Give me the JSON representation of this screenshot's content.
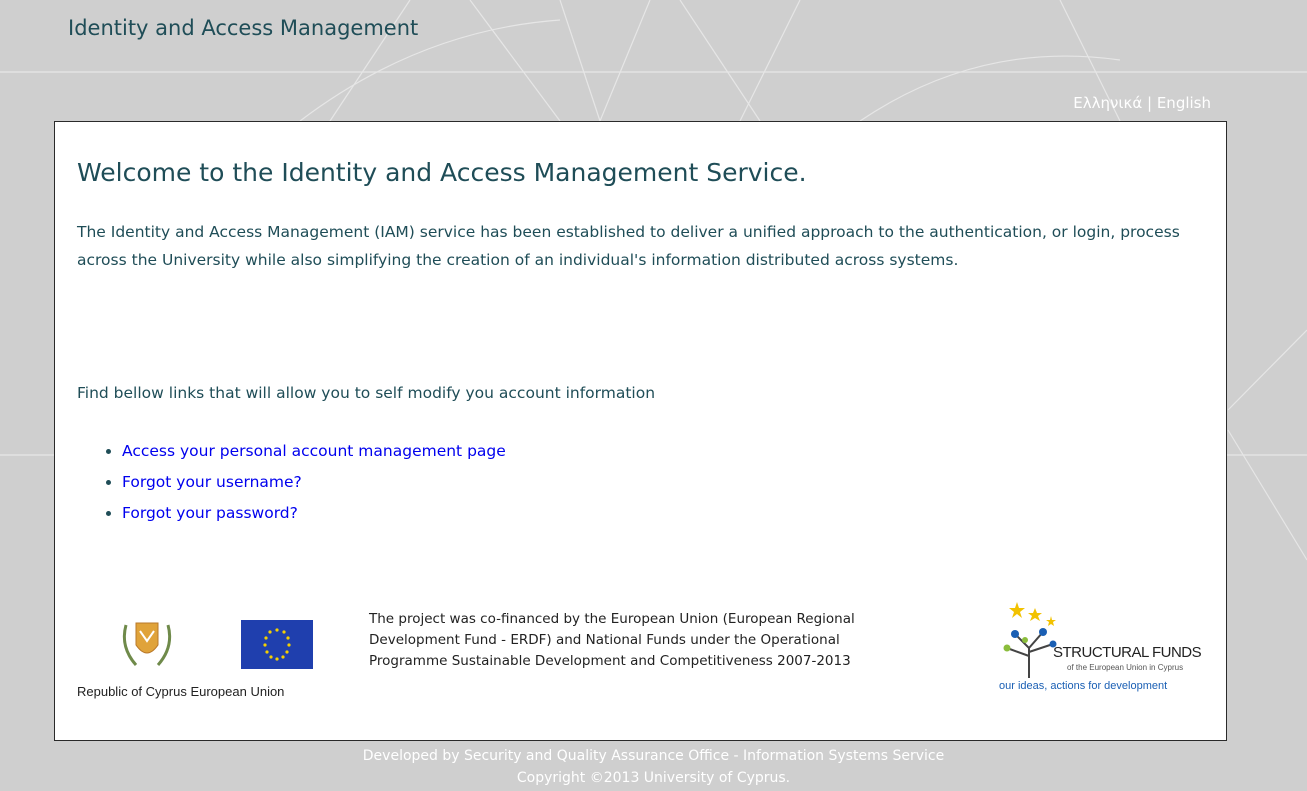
{
  "header": {
    "site_title": "Identity and Access Management",
    "languages": [
      {
        "label": "Ελληνικά"
      },
      {
        "separator": "|"
      },
      {
        "label": "English"
      }
    ]
  },
  "main": {
    "heading": "Welcome to the Identity and Access Management Service.",
    "intro": "The Identity and Access Management (IAM) service has been established to deliver a unified approach to the authentication, or login, process across the University while also simplifying the creation of an individual's information distributed across systems.",
    "find_text": "Find bellow links that will allow you to self modify you account information",
    "links": [
      {
        "label": "Access your personal account management page"
      },
      {
        "label": "Forgot your username?"
      },
      {
        "label": "Forgot your password?"
      }
    ]
  },
  "logos": {
    "cyprus_label": "Republic of Cyprus",
    "eu_label": "European Union",
    "cofinance_text": "The project was co-financed by the European Union (European Regional Development Fund - ERDF) and National Funds under the Operational Programme Sustainable Development and Competitiveness 2007-2013",
    "structural_funds": {
      "title": "STRUCTURAL FUNDS",
      "subtitle": "of the European Union in Cyprus",
      "tagline": "our ideas, actions for development"
    }
  },
  "footer": {
    "developed_by": "Developed by Security and Quality Assurance Office - Information Systems Service",
    "copyright": "Copyright ©2013 University of Cyprus."
  },
  "colors": {
    "background": "#cfcfcf",
    "heading": "#1f4d57",
    "link": "#0000ee",
    "panel": "#ffffff"
  }
}
